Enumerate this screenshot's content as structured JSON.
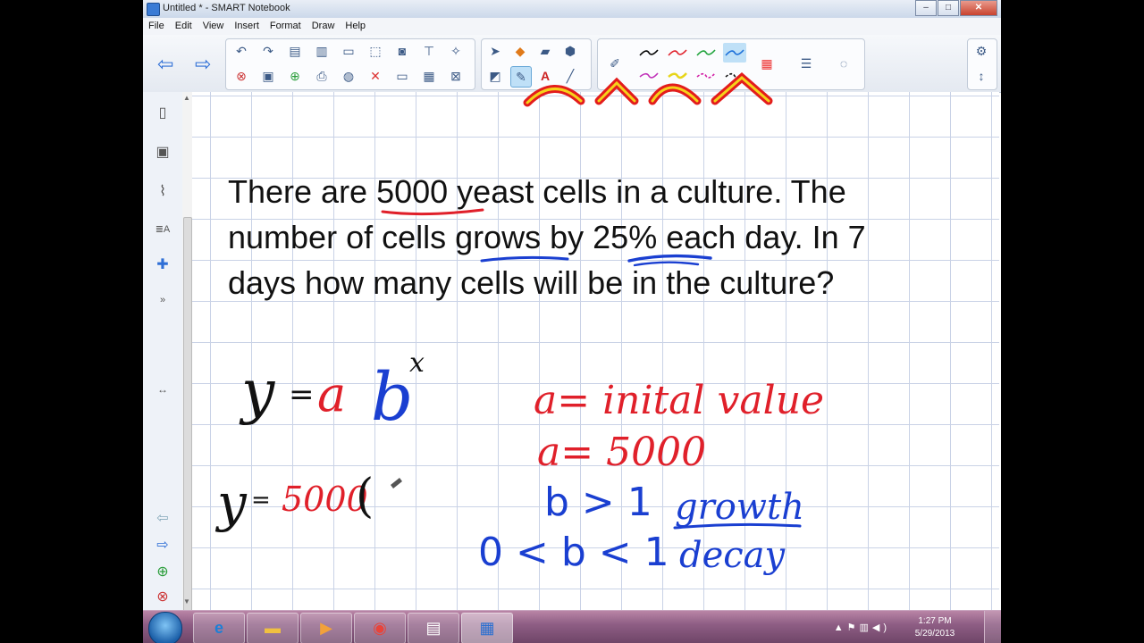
{
  "window": {
    "title": "Untitled * - SMART Notebook",
    "controls": {
      "minimize": "–",
      "maximize": "□",
      "close": "✕"
    }
  },
  "menu": [
    "File",
    "Edit",
    "View",
    "Insert",
    "Format",
    "Draw",
    "Help"
  ],
  "toolbar": {
    "icons": {
      "back": "arrow-left-icon",
      "forward": "arrow-right-icon",
      "undo": "undo-icon",
      "redo": "redo-icon",
      "delete": "delete-icon",
      "save": "save-icon",
      "pen_colors": [
        "#000000",
        "#e0202a",
        "#1fa33a",
        "#1b6fd9",
        "#c02fb8",
        "#e7d51a",
        "#d21ea5",
        "#111111"
      ]
    }
  },
  "problem": {
    "line1": "There are 5000 yeast cells in a culture.  The",
    "line2": "number of cells grows by 25% each day.  In 7",
    "line3": "days how many cells will be in the culture?"
  },
  "ink": {
    "formula_y": "y",
    "formula_eq": "=",
    "formula_a": "a",
    "formula_b": "b",
    "formula_x": "x",
    "note_a_initial": "a= inital value",
    "note_a_value": "a= 5000",
    "note_growth_cond": "b > 1",
    "note_growth": "growth",
    "note_decay_cond": "0 < b < 1",
    "note_decay": "decay",
    "step2_y": "y",
    "step2_eq": "=",
    "step2_val": "5000",
    "step2_paren": "("
  },
  "colors": {
    "ink_black": "#111111",
    "ink_red": "#e0202a",
    "ink_blue": "#1a3fd1"
  },
  "taskbar": {
    "apps": [
      "start-orb",
      "internet-explorer",
      "file-explorer",
      "media-player",
      "chrome",
      "network-app",
      "smart-notebook"
    ],
    "clock_time": "1:27 PM",
    "clock_date": "5/29/2013"
  }
}
